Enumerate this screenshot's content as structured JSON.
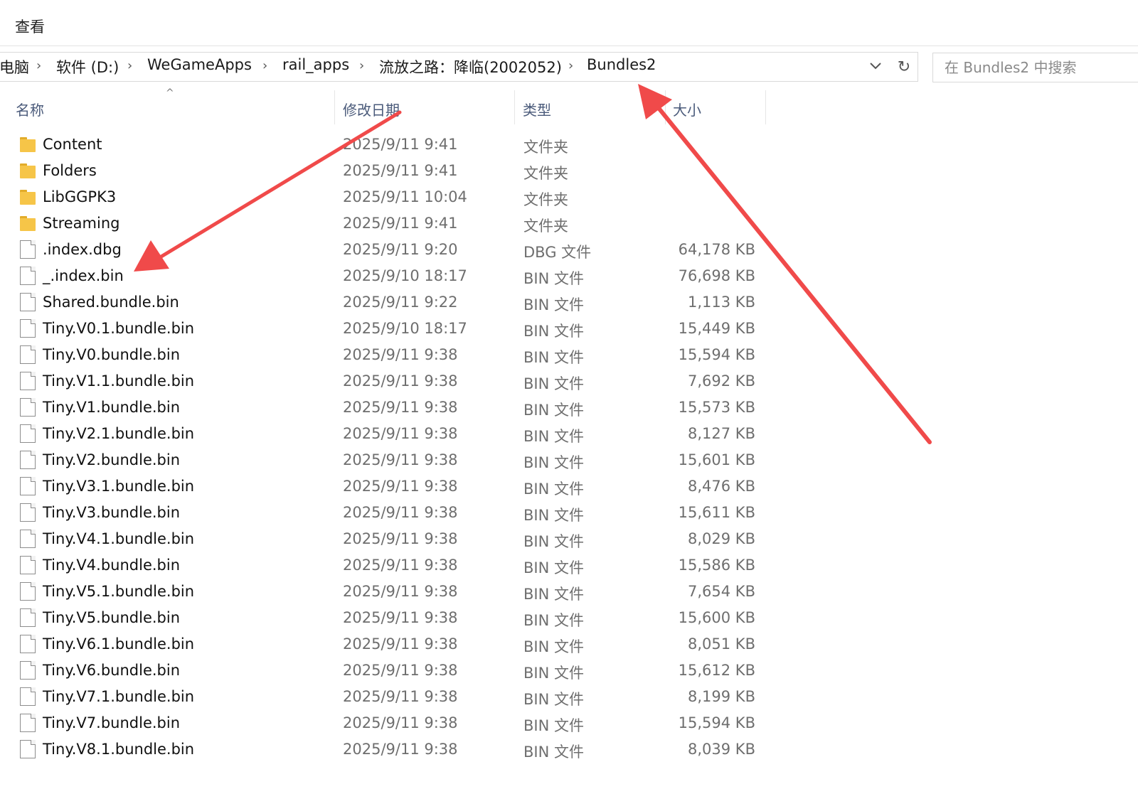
{
  "menu": {
    "view_label": "查看"
  },
  "breadcrumb": {
    "items": [
      "电脑",
      "软件 (D:)",
      "WeGameApps",
      "rail_apps",
      "流放之路：降临(2002052)",
      "Bundles2"
    ]
  },
  "search": {
    "placeholder": "在 Bundles2 中搜索"
  },
  "columns": {
    "name": "名称",
    "date": "修改日期",
    "type": "类型",
    "size": "大小"
  },
  "files": [
    {
      "name": "Content",
      "date": "2025/9/11 9:41",
      "type": "文件夹",
      "size": "",
      "kind": "folder"
    },
    {
      "name": "Folders",
      "date": "2025/9/11 9:41",
      "type": "文件夹",
      "size": "",
      "kind": "folder"
    },
    {
      "name": "LibGGPK3",
      "date": "2025/9/11 10:04",
      "type": "文件夹",
      "size": "",
      "kind": "folder"
    },
    {
      "name": "Streaming",
      "date": "2025/9/11 9:41",
      "type": "文件夹",
      "size": "",
      "kind": "folder"
    },
    {
      "name": ".index.dbg",
      "date": "2025/9/11 9:20",
      "type": "DBG 文件",
      "size": "64,178 KB",
      "kind": "file"
    },
    {
      "name": "_.index.bin",
      "date": "2025/9/10 18:17",
      "type": "BIN 文件",
      "size": "76,698 KB",
      "kind": "file"
    },
    {
      "name": "Shared.bundle.bin",
      "date": "2025/9/11 9:22",
      "type": "BIN 文件",
      "size": "1,113 KB",
      "kind": "file"
    },
    {
      "name": "Tiny.V0.1.bundle.bin",
      "date": "2025/9/10 18:17",
      "type": "BIN 文件",
      "size": "15,449 KB",
      "kind": "file"
    },
    {
      "name": "Tiny.V0.bundle.bin",
      "date": "2025/9/11 9:38",
      "type": "BIN 文件",
      "size": "15,594 KB",
      "kind": "file"
    },
    {
      "name": "Tiny.V1.1.bundle.bin",
      "date": "2025/9/11 9:38",
      "type": "BIN 文件",
      "size": "7,692 KB",
      "kind": "file"
    },
    {
      "name": "Tiny.V1.bundle.bin",
      "date": "2025/9/11 9:38",
      "type": "BIN 文件",
      "size": "15,573 KB",
      "kind": "file"
    },
    {
      "name": "Tiny.V2.1.bundle.bin",
      "date": "2025/9/11 9:38",
      "type": "BIN 文件",
      "size": "8,127 KB",
      "kind": "file"
    },
    {
      "name": "Tiny.V2.bundle.bin",
      "date": "2025/9/11 9:38",
      "type": "BIN 文件",
      "size": "15,601 KB",
      "kind": "file"
    },
    {
      "name": "Tiny.V3.1.bundle.bin",
      "date": "2025/9/11 9:38",
      "type": "BIN 文件",
      "size": "8,476 KB",
      "kind": "file"
    },
    {
      "name": "Tiny.V3.bundle.bin",
      "date": "2025/9/11 9:38",
      "type": "BIN 文件",
      "size": "15,611 KB",
      "kind": "file"
    },
    {
      "name": "Tiny.V4.1.bundle.bin",
      "date": "2025/9/11 9:38",
      "type": "BIN 文件",
      "size": "8,029 KB",
      "kind": "file"
    },
    {
      "name": "Tiny.V4.bundle.bin",
      "date": "2025/9/11 9:38",
      "type": "BIN 文件",
      "size": "15,586 KB",
      "kind": "file"
    },
    {
      "name": "Tiny.V5.1.bundle.bin",
      "date": "2025/9/11 9:38",
      "type": "BIN 文件",
      "size": "7,654 KB",
      "kind": "file"
    },
    {
      "name": "Tiny.V5.bundle.bin",
      "date": "2025/9/11 9:38",
      "type": "BIN 文件",
      "size": "15,600 KB",
      "kind": "file"
    },
    {
      "name": "Tiny.V6.1.bundle.bin",
      "date": "2025/9/11 9:38",
      "type": "BIN 文件",
      "size": "8,051 KB",
      "kind": "file"
    },
    {
      "name": "Tiny.V6.bundle.bin",
      "date": "2025/9/11 9:38",
      "type": "BIN 文件",
      "size": "15,612 KB",
      "kind": "file"
    },
    {
      "name": "Tiny.V7.1.bundle.bin",
      "date": "2025/9/11 9:38",
      "type": "BIN 文件",
      "size": "8,199 KB",
      "kind": "file"
    },
    {
      "name": "Tiny.V7.bundle.bin",
      "date": "2025/9/11 9:38",
      "type": "BIN 文件",
      "size": "15,594 KB",
      "kind": "file"
    },
    {
      "name": "Tiny.V8.1.bundle.bin",
      "date": "2025/9/11 9:38",
      "type": "BIN 文件",
      "size": "8,039 KB",
      "kind": "file"
    }
  ],
  "annotation_color": "#f04a4a"
}
